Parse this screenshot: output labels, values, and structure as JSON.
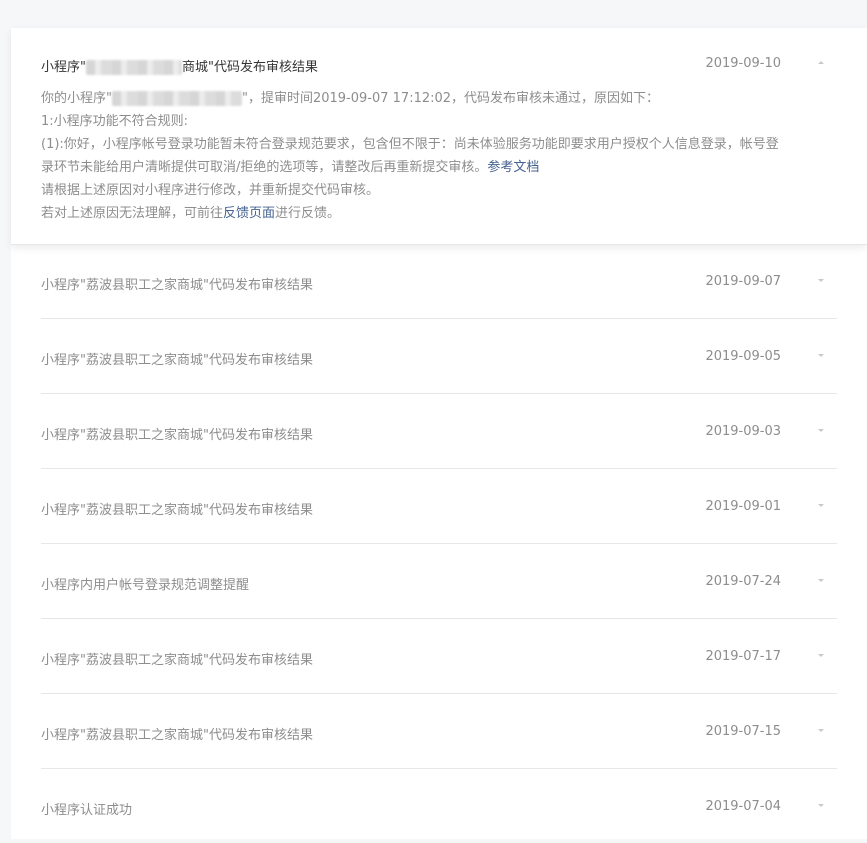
{
  "expanded": {
    "title_prefix": "小程序\"",
    "title_suffix": "商城\"代码发布审核结果",
    "date": "2019-09-10",
    "line1_prefix": "你的小程序\"",
    "line1_suffix": "\"，提审时间2019-09-07 17:12:02，代码发布审核未通过，原因如下：",
    "line2": "1:小程序功能不符合规则:",
    "line3": "(1):你好，小程序帐号登录功能暂未符合登录规范要求，包含但不限于：尚未体验服务功能即要求用户授权个人信息登录，帐号登录环节未能给用户清晰提供可取消/拒绝的选项等，请整改后再重新提交审核。",
    "line3_link": "参考文档",
    "line4": "请根据上述原因对小程序进行修改，并重新提交代码审核。",
    "line5_prefix": "若对上述原因无法理解，可前往",
    "line5_link": "反馈页面",
    "line5_suffix": "进行反馈。"
  },
  "messages": [
    {
      "title": "小程序\"荔波县职工之家商城\"代码发布审核结果",
      "date": "2019-09-07"
    },
    {
      "title": "小程序\"荔波县职工之家商城\"代码发布审核结果",
      "date": "2019-09-05"
    },
    {
      "title": "小程序\"荔波县职工之家商城\"代码发布审核结果",
      "date": "2019-09-03"
    },
    {
      "title": "小程序\"荔波县职工之家商城\"代码发布审核结果",
      "date": "2019-09-01"
    },
    {
      "title": "小程序内用户帐号登录规范调整提醒",
      "date": "2019-07-24"
    },
    {
      "title": "小程序\"荔波县职工之家商城\"代码发布审核结果",
      "date": "2019-07-17"
    },
    {
      "title": "小程序\"荔波县职工之家商城\"代码发布审核结果",
      "date": "2019-07-15"
    },
    {
      "title": "小程序认证成功",
      "date": "2019-07-04"
    }
  ],
  "colors": {
    "link": "#45628f",
    "text_primary": "#353535",
    "text_secondary": "#8d8d8d",
    "divider": "#e7e7eb"
  }
}
